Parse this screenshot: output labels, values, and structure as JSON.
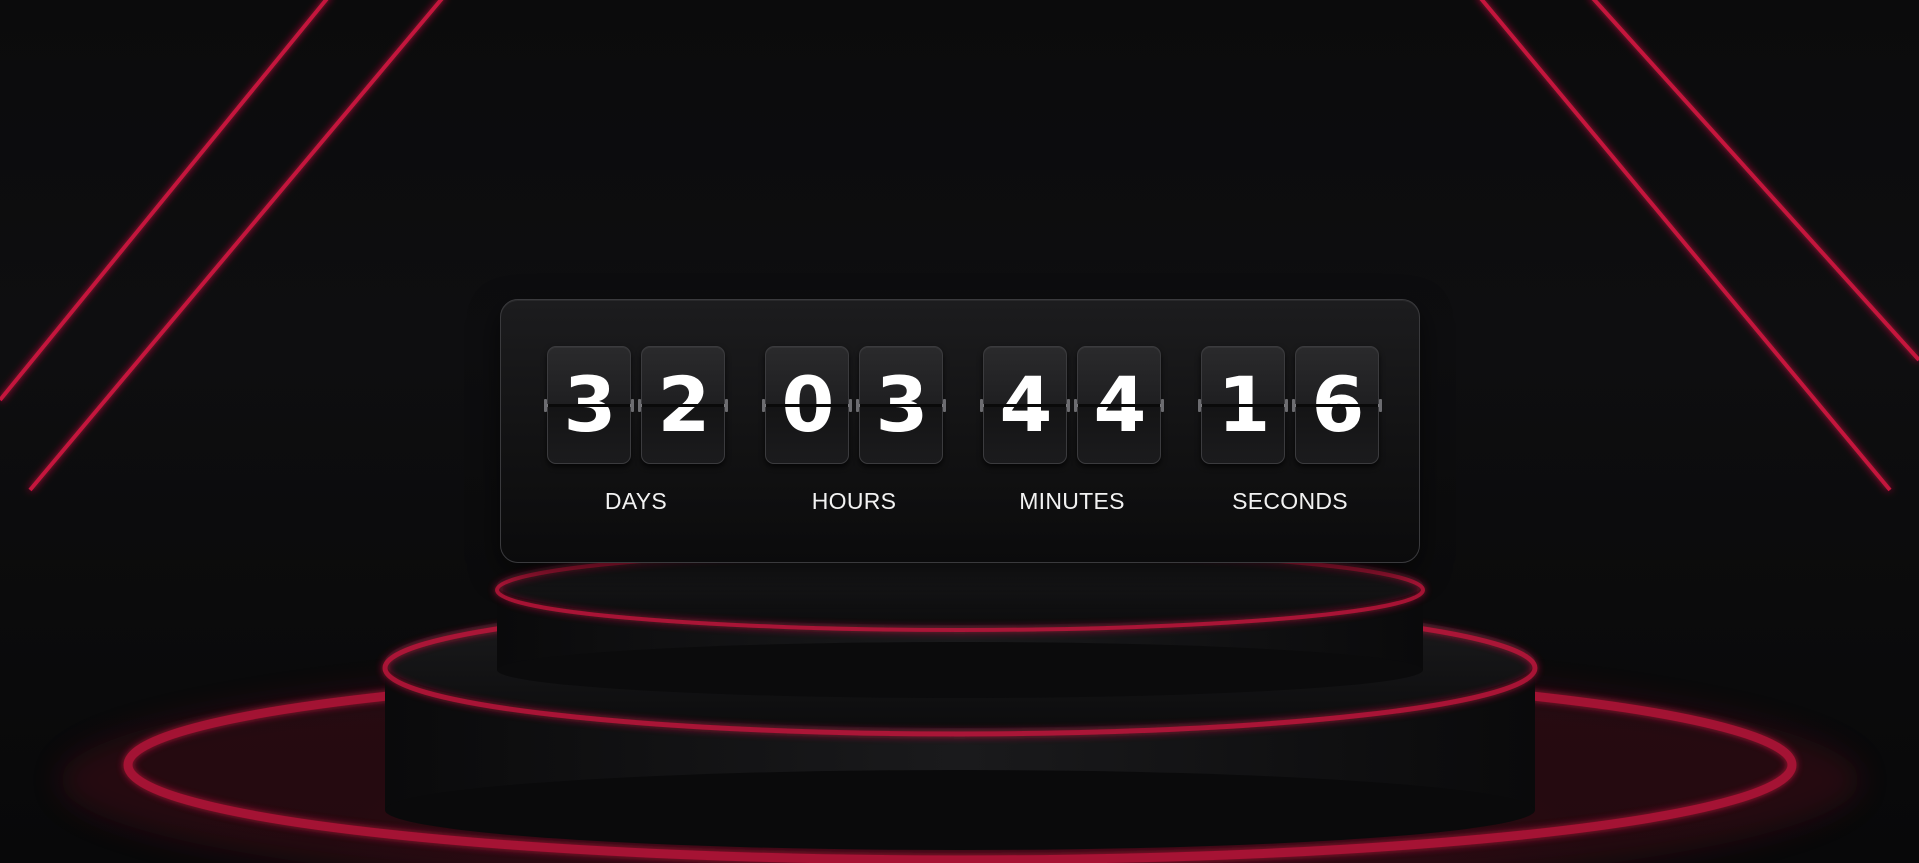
{
  "countdown": {
    "units": [
      {
        "label": "DAYS",
        "digits": [
          "3",
          "2"
        ]
      },
      {
        "label": "HOURS",
        "digits": [
          "0",
          "3"
        ]
      },
      {
        "label": "MINUTES",
        "digits": [
          "4",
          "4"
        ]
      },
      {
        "label": "SECONDS",
        "digits": [
          "1",
          "6"
        ]
      }
    ]
  },
  "colors": {
    "accent_neon": "#c4123c",
    "panel_bg": "#151516",
    "digit_color": "#ffffff",
    "label_color": "#f2f2f2"
  }
}
